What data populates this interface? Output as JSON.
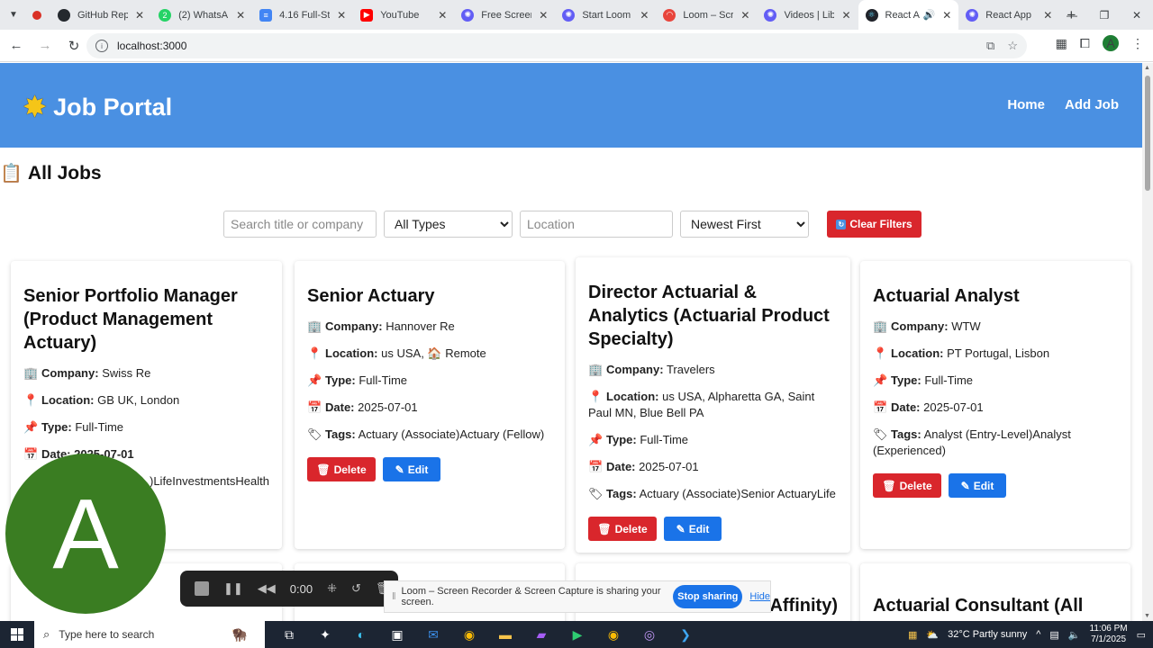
{
  "browser": {
    "tabs": [
      {
        "label": "",
        "fav": "#d93025",
        "icon": "record-icon"
      },
      {
        "label": "GitHub Rep",
        "fav": "#24292e",
        "icon": "github-icon"
      },
      {
        "label": "(2) WhatsA",
        "fav": "#25d366",
        "icon": "whatsapp-icon"
      },
      {
        "label": "4.16 Full-St",
        "fav": "#4285f4",
        "icon": "docs-icon"
      },
      {
        "label": "YouTube",
        "fav": "#ff0000",
        "icon": "youtube-icon"
      },
      {
        "label": "Free Screen",
        "fav": "#625df5",
        "icon": "loom-icon"
      },
      {
        "label": "Start Loom",
        "fav": "#625df5",
        "icon": "loom-icon"
      },
      {
        "label": "Loom – Scr",
        "fav": "#e8453c",
        "icon": "loom-icon"
      },
      {
        "label": "Videos | Lib",
        "fav": "#625df5",
        "icon": "loom-icon"
      },
      {
        "label": "React A",
        "fav": "#20232a",
        "icon": "react-icon",
        "active": true
      },
      {
        "label": "React App",
        "fav": "#625df5",
        "icon": "react-icon"
      }
    ],
    "url": "localhost:3000"
  },
  "header": {
    "brand": "Job Portal",
    "nav": {
      "home": "Home",
      "add_job": "Add Job"
    }
  },
  "page_title": "All Jobs",
  "filters": {
    "search_placeholder": "Search title or company",
    "type_selected": "All Types",
    "location_placeholder": "Location",
    "sort_selected": "Newest First",
    "clear_label": "Clear Filters"
  },
  "labels": {
    "company": "Company:",
    "location": "Location:",
    "type": "Type:",
    "date": "Date:",
    "tags": "Tags:",
    "delete": "Delete",
    "edit": "Edit"
  },
  "jobs": [
    {
      "title": "Senior Portfolio Manager (Product Management Actuary)",
      "company": "Swiss Re",
      "location": "GB UK, London",
      "type": "Full-Time",
      "date": "Date: 2025-07-01",
      "tags": ")LifeInvestmentsHealth"
    },
    {
      "title": "Senior Actuary",
      "company": "Hannover Re",
      "location": "us USA, 🏠 Remote",
      "type": "Full-Time",
      "date": "2025-07-01",
      "tags": "Actuary (Associate)Actuary (Fellow)"
    },
    {
      "title": "Director Actuarial & Analytics (Actuarial Product Specialty)",
      "company": "Travelers",
      "location": "us USA, Alpharetta GA, Saint Paul MN, Blue Bell PA",
      "type": "Full-Time",
      "date": "2025-07-01",
      "tags": "Actuary (Associate)Senior ActuaryLife"
    },
    {
      "title": "Actuarial Analyst",
      "company": "WTW",
      "location": "PT Portugal, Lisbon",
      "type": "Full-Time",
      "date": "2025-07-01",
      "tags": "Analyst (Entry-Level)Analyst (Experienced)"
    },
    {
      "title": "Affinity)"
    },
    {
      "title": "Actuarial Consultant (All"
    }
  ],
  "loom": {
    "avatar_letter": "A",
    "timer": "0:00",
    "sharing_text": "Loom – Screen Recorder & Screen Capture is sharing your screen.",
    "stop_label": "Stop sharing",
    "hide_label": "Hide"
  },
  "taskbar": {
    "search_placeholder": "Type here to search",
    "weather": "32°C  Partly sunny",
    "time": "11:06 PM",
    "date": "7/1/2025"
  }
}
